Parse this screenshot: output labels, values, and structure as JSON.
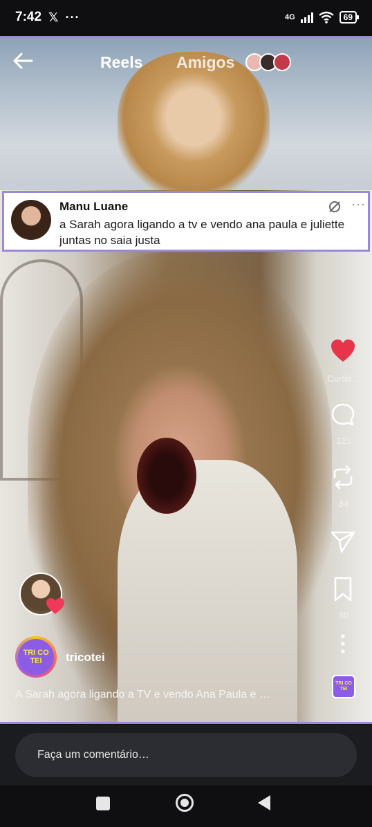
{
  "status_bar": {
    "time": "7:42",
    "x_icon": "x-logo-icon",
    "more": "···",
    "network": "4G",
    "battery": "69"
  },
  "header": {
    "back_icon": "back-arrow-icon",
    "tab_reels": "Reels",
    "tab_amigos": "Amigos"
  },
  "post": {
    "author": "Manu Luane",
    "text": "a Sarah agora ligando a tv e vendo ana paula e juliette juntas no saia justa",
    "more": "···"
  },
  "actions": {
    "like_label": "Curtid…",
    "comments_count": "123",
    "reposts_count": "84",
    "saves_count": "80",
    "colors": {
      "like": "#e8344a"
    }
  },
  "reel": {
    "channel": "tricotei",
    "logo_text": "TRI CO TEI",
    "caption": "A Sarah agora ligando a TV e vendo Ana Paula e …"
  },
  "comment_bar": {
    "placeholder": "Faça um comentário…"
  },
  "nav": {
    "icons": [
      "recents-square-icon",
      "home-circle-icon",
      "back-triangle-icon"
    ]
  }
}
